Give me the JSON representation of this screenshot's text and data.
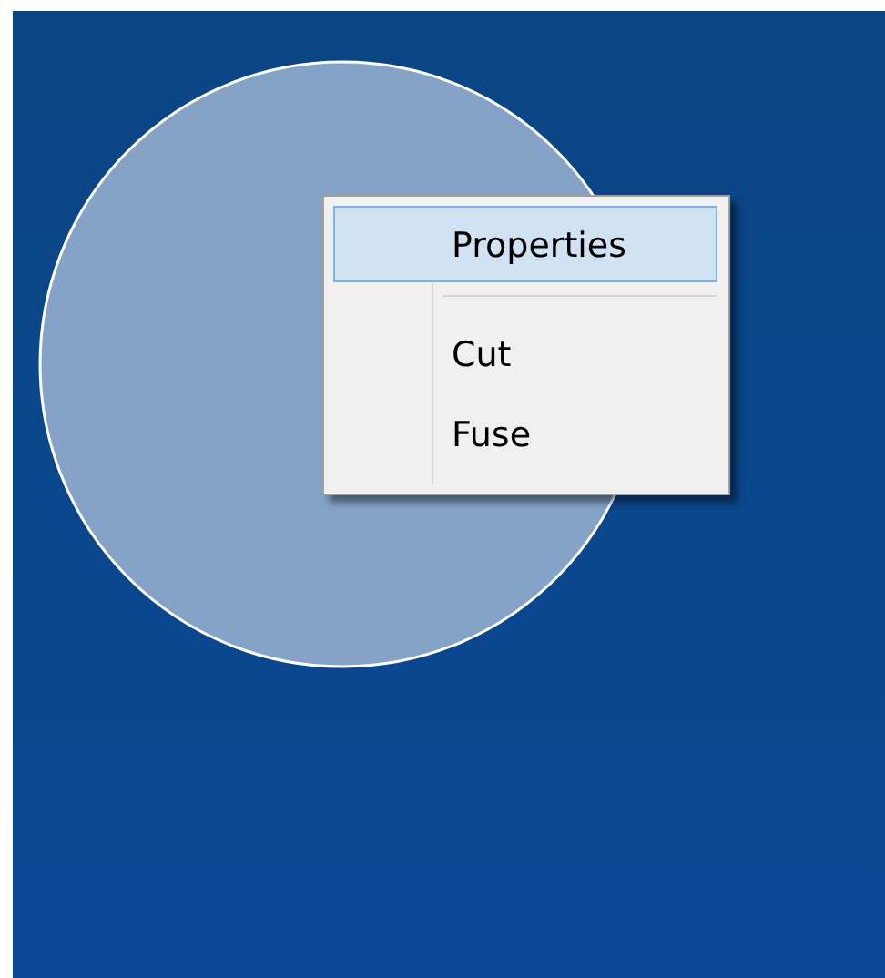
{
  "context_menu": {
    "items": [
      {
        "kind": "item",
        "label": "Properties",
        "selected": true
      },
      {
        "kind": "separator"
      },
      {
        "kind": "item",
        "label": "Cut",
        "selected": false
      },
      {
        "kind": "item",
        "label": "Fuse",
        "selected": false
      }
    ]
  }
}
